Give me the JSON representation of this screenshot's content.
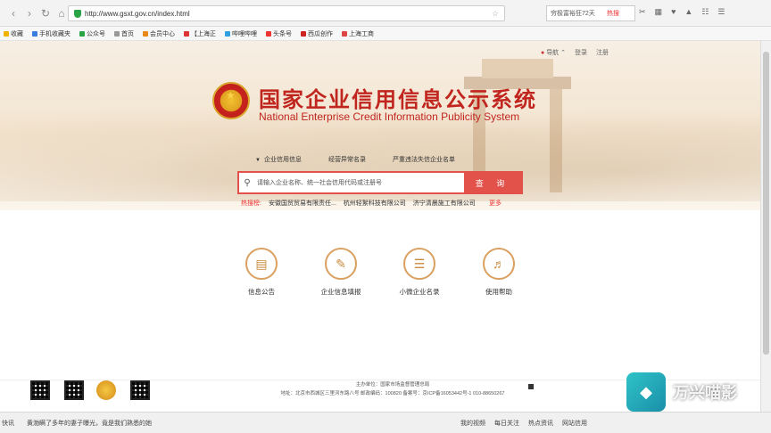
{
  "browser": {
    "url": "http://www.gsxt.gov.cn/index.html",
    "search_text": "穷极富裕狂72天",
    "hot_label": "热搜",
    "bookmarks": [
      "收藏",
      "手机收藏夹",
      "公众号",
      "首页",
      "会员中心",
      "【上海正",
      "哔哩哔哩",
      "头条号",
      "西瓜创作",
      "上海工商"
    ]
  },
  "page": {
    "top_links": {
      "nav": "导航",
      "login": "登录",
      "register": "注册"
    },
    "title_cn": "国家企业信用信息公示系统",
    "title_en": "National Enterprise Credit Information Publicity System",
    "tabs": [
      "企业信用信息",
      "经营异常名录",
      "严重违法失信企业名单"
    ],
    "search": {
      "placeholder": "请输入企业名称、统一社会信用代码或注册号",
      "button": "查 询"
    },
    "hot": {
      "label": "热搜榜:",
      "items": [
        "安徽国贸贸易有限责任...",
        "杭州轻絮科技有限公司",
        "济宁清晨施工有限公司"
      ],
      "more": "更多"
    },
    "services": [
      {
        "label": "信息公告",
        "icon": "document-icon"
      },
      {
        "label": "企业信息填报",
        "icon": "pen-icon"
      },
      {
        "label": "小微企业名录",
        "icon": "list-icon"
      },
      {
        "label": "使用帮助",
        "icon": "speaker-icon"
      }
    ],
    "footer": {
      "line1": "主办单位：国家市场监督管理总局",
      "line2": "地址：北京市西城区三里河东路八号  邮政编码：100820  备案号：京ICP备16053442号-1  010-88650267"
    }
  },
  "statusbar": {
    "left": "快讯",
    "news": "黄渤瞒了多年的妻子曝光，竟是我们熟悉的她",
    "items": [
      "我的视频",
      "每日关注",
      "热点资讯",
      "网站信用"
    ]
  },
  "watermark": {
    "text": "万兴喵影"
  }
}
